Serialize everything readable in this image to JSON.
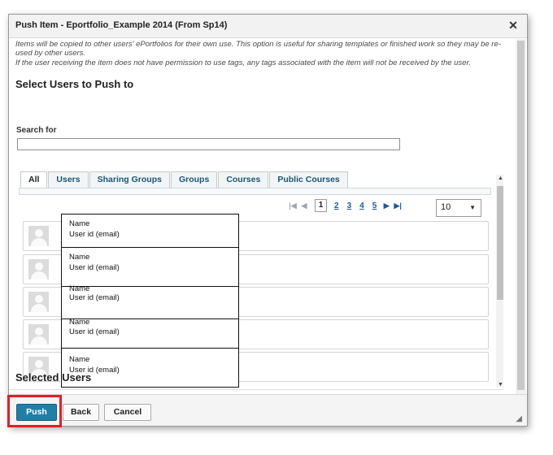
{
  "dialog": {
    "title": "Push Item - Eportfolio_Example 2014 (From Sp14)",
    "close_label": "✕",
    "intro_line1": "Items will be copied to other users' ePortfolios for their own use. This option is useful for sharing templates or finished work so they may be re-used by other users.",
    "intro_line2": "If the user receiving the item does not have permission to use tags, any tags associated with the item will not be received by the user."
  },
  "select_users": {
    "heading": "Select Users to Push to",
    "search_label": "Search for",
    "search_value": ""
  },
  "tabs": [
    {
      "label": "All",
      "active": true
    },
    {
      "label": "Users",
      "active": false
    },
    {
      "label": "Sharing Groups",
      "active": false
    },
    {
      "label": "Groups",
      "active": false
    },
    {
      "label": "Courses",
      "active": false
    },
    {
      "label": "Public Courses",
      "active": false
    }
  ],
  "pager": {
    "current": "1",
    "pages": [
      "2",
      "3",
      "4",
      "5"
    ],
    "page_size": "10"
  },
  "users": [
    {
      "name": "Name",
      "user_id": "User id (email)"
    },
    {
      "name": "Name",
      "user_id": "User id (email)"
    },
    {
      "name": "Name",
      "user_id": "User id (email)"
    },
    {
      "name": "Name",
      "user_id": "User id (email)"
    },
    {
      "name": "Name",
      "user_id": "User id (email)"
    }
  ],
  "selected_users": {
    "heading": "Selected Users"
  },
  "footer": {
    "push_label": "Push",
    "back_label": "Back",
    "cancel_label": "Cancel"
  },
  "colors": {
    "primary_button": "#1f7fa6",
    "link": "#1a5a9c",
    "highlight_border": "#e01f26"
  }
}
